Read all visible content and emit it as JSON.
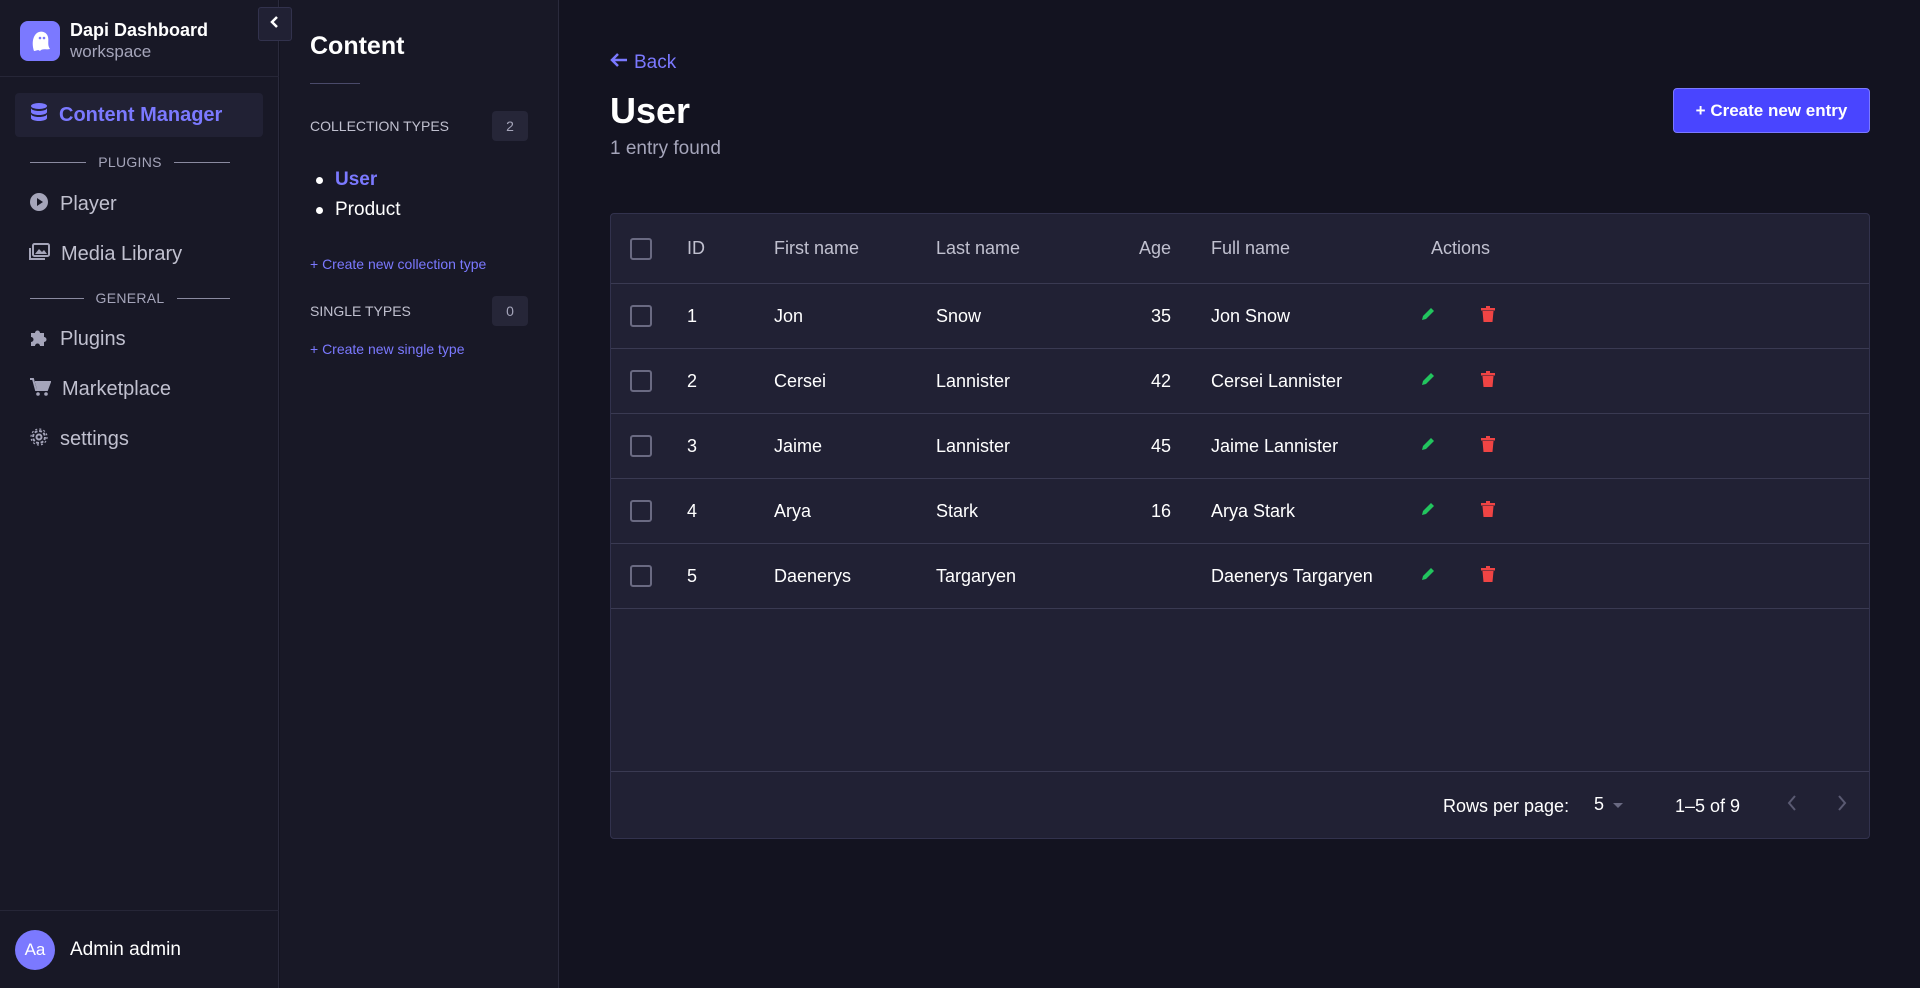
{
  "brand": {
    "title": "Dapi Dashboard",
    "subtitle": "workspace"
  },
  "sidebar": {
    "active_item": "Content Manager",
    "section_plugins": "PLUGINS",
    "section_general": "GENERAL",
    "plugins": [
      {
        "label": "Player",
        "icon": "play-circle-icon"
      },
      {
        "label": "Media Library",
        "icon": "images-icon"
      }
    ],
    "general": [
      {
        "label": "Plugins",
        "icon": "puzzle-icon"
      },
      {
        "label": "Marketplace",
        "icon": "cart-icon"
      },
      {
        "label": "settings",
        "icon": "gear-icon"
      }
    ]
  },
  "user": {
    "initials": "Aa",
    "name": "Admin admin"
  },
  "content_panel": {
    "title": "Content",
    "collection_types_label": "COLLECTION TYPES",
    "collection_types_count": "2",
    "collection_types": [
      {
        "label": "User",
        "active": true
      },
      {
        "label": "Product",
        "active": false
      }
    ],
    "create_collection_label": "+ Create new collection type",
    "single_types_label": "SINGLE TYPES",
    "single_types_count": "0",
    "create_single_label": "+ Create new single type"
  },
  "main": {
    "back_label": "Back",
    "title": "User",
    "entry_count": "1 entry found",
    "create_entry_label": "+ Create new entry"
  },
  "table": {
    "columns": [
      "ID",
      "First name",
      "Last name",
      "Age",
      "Full name",
      "Actions"
    ],
    "rows": [
      {
        "id": "1",
        "first": "Jon",
        "last": "Snow",
        "age": "35",
        "full": "Jon Snow"
      },
      {
        "id": "2",
        "first": "Cersei",
        "last": "Lannister",
        "age": "42",
        "full": "Cersei Lannister"
      },
      {
        "id": "3",
        "first": "Jaime",
        "last": "Lannister",
        "age": "45",
        "full": "Jaime Lannister"
      },
      {
        "id": "4",
        "first": "Arya",
        "last": "Stark",
        "age": "16",
        "full": "Arya Stark"
      },
      {
        "id": "5",
        "first": "Daenerys",
        "last": "Targaryen",
        "age": "",
        "full": "Daenerys Targaryen"
      }
    ]
  },
  "pagination": {
    "rows_per_page_label": "Rows per page:",
    "rows_per_page_value": "5",
    "range_label": "1–5 of 9"
  },
  "colors": {
    "accent": "#7b79ff",
    "primary_button": "#4945ff",
    "edit": "#22c55e",
    "delete": "#ef4444"
  }
}
